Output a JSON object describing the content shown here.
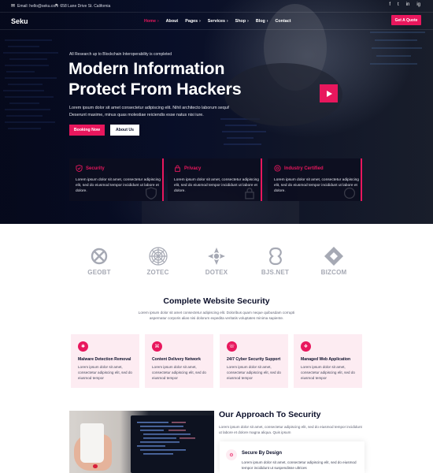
{
  "colors": {
    "accent": "#e8175d",
    "dark": "#0b0f2a",
    "pink_bg": "#fdecf2",
    "brand_gray": "#a6a9b4"
  },
  "topbar": {
    "email": "Email: hello@seku.com",
    "address": "658 Lane Drive St. California",
    "social": [
      "f",
      "t",
      "in",
      "ig"
    ]
  },
  "nav": {
    "logo": "Seku",
    "items": [
      "Home",
      "About",
      "Pages",
      "Services",
      "Shop",
      "Blog",
      "Contact"
    ],
    "cta": "Get A Quote"
  },
  "hero": {
    "eyebrow": "All Research up to Blockchain Interoperability is completed",
    "title_line1": "Modern Information",
    "title_line2": "Protect From Hackers",
    "description": "Lorem ipsum dolor sit amet consectetur adipiscing elit. Nihil architecto laborum sequi! Deserunt maxime, minus quas molestiae reiciendis esse natus nisi iure.",
    "btn_primary": "Booking Now",
    "btn_secondary": "About Us"
  },
  "features": [
    {
      "title": "Security",
      "icon": "shield-check-icon",
      "desc": "Lorem ipsum dolor sit amet, consectetur adipiscing elit, sed do eiusmod tempor incididunt ut labore et dolore."
    },
    {
      "title": "Privacy",
      "icon": "lock-icon",
      "desc": "Lorem ipsum dolor sit amet, consectetur adipiscing elit, sed do eiusmod tempor incididunt ut labore et dolore."
    },
    {
      "title": "Industry Certified",
      "icon": "certificate-icon",
      "desc": "Lorem ipsum dolor sit amet, consectetur adipiscing elit, sed do eiusmod tempor incididunt ut labore et dolore."
    }
  ],
  "brands": [
    "GEOBT",
    "ZOTEC",
    "DOTEX",
    "BJS.NET",
    "BIZCOM"
  ],
  "security": {
    "title": "Complete Website Security",
    "description": "Lorem ipsum dolor sit amet consectetur adipiscing elit. Doloribus quam neque quibusdam corrupti aspernatur corporis alias nisi dolorum expedita veritatis voluptates minima sapiente.",
    "services": [
      {
        "title": "Malware Detection Removal",
        "icon": "bug-icon",
        "desc": "Lorem ipsum dolor sit amet, consectetur adipiscing elit, sed do eiusmod tempor"
      },
      {
        "title": "Content Delivery Network",
        "icon": "network-icon",
        "desc": "Lorem ipsum dolor sit amet, consectetur adipiscing elit, sed do eiusmod tempor"
      },
      {
        "title": "24/7 Cyber Security Support",
        "icon": "support-icon",
        "desc": "Lorem ipsum dolor sit amet, consectetur adipiscing elit, sed do eiusmod tempor"
      },
      {
        "title": "Managed Web Application",
        "icon": "web-app-icon",
        "desc": "Lorem ipsum dolor sit amet, consectetur adipiscing elit, sed do eiusmod tempor"
      }
    ]
  },
  "approach": {
    "title": "Our Approach To Security",
    "description": "Lorem ipsum dolor sit amet, consectetur adipiscing elit, sed do eiusmod tempor incididunt ut labore et dolore magna aliqua. Quis ipsum",
    "card_title": "Secure By Design",
    "card_desc": "Lorem ipsum dolor sit amet, consectetur adipiscing elit, sed do eiusmod tempor incididunt ut suspendisse ultrices"
  }
}
